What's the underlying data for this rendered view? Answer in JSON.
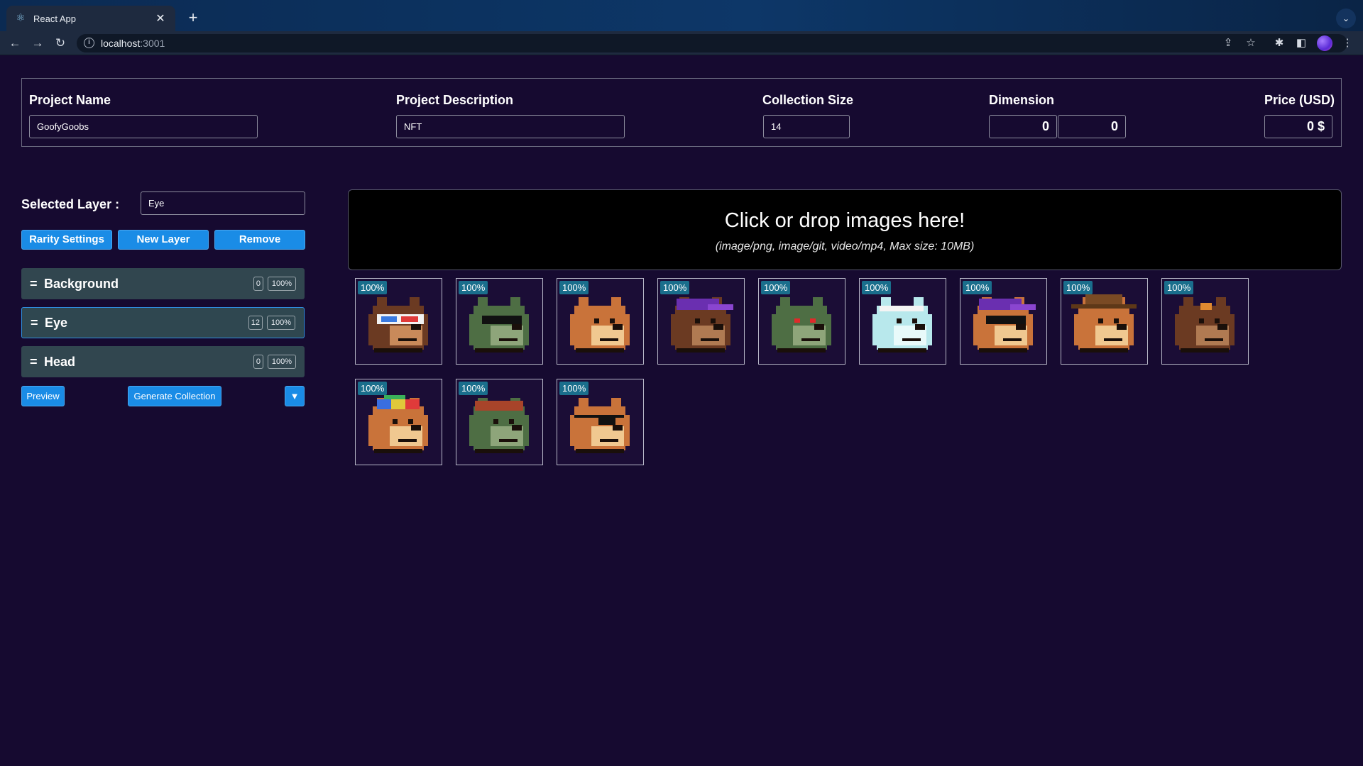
{
  "browser": {
    "tab_title": "React App",
    "url_host": "localhost",
    "url_port": ":3001"
  },
  "project": {
    "name_label": "Project Name",
    "name_value": "GoofyGoobs",
    "description_label": "Project Description",
    "description_value": "NFT",
    "collection_size_label": "Collection Size",
    "collection_size_value": "14",
    "dimension_label": "Dimension",
    "dimension_width": "0",
    "dimension_height": "0",
    "price_label": "Price (USD)",
    "price_value": "0 $"
  },
  "layers_panel": {
    "selected_label": "Selected Layer :",
    "selected_value": "Eye",
    "rarity_button": "Rarity Settings",
    "new_layer_button": "New Layer",
    "remove_button": "Remove",
    "handle_glyph": "=",
    "layers": [
      {
        "name": "Background",
        "count": "0",
        "percent": "100%",
        "selected": false
      },
      {
        "name": "Eye",
        "count": "12",
        "percent": "100%",
        "selected": true
      },
      {
        "name": "Head",
        "count": "0",
        "percent": "100%",
        "selected": false
      }
    ],
    "preview_button": "Preview",
    "generate_button": "Generate Collection",
    "dropdown_glyph": "▼"
  },
  "dropzone": {
    "title": "Click or drop images here!",
    "subtitle": "(image/png, image/git, video/mp4, Max size: 10MB)"
  },
  "images": [
    {
      "badge": "100%",
      "fur": "#6b3a22",
      "snout": "#c98a5a",
      "accessory": "3d-glasses"
    },
    {
      "badge": "100%",
      "fur": "#4e6e44",
      "snout": "#8ea57a",
      "accessory": "sunglasses"
    },
    {
      "badge": "100%",
      "fur": "#c9733a",
      "snout": "#f0c890",
      "accessory": "none"
    },
    {
      "badge": "100%",
      "fur": "#6b3a22",
      "snout": "#b07a52",
      "accessory": "purple-cap"
    },
    {
      "badge": "100%",
      "fur": "#4e6e44",
      "snout": "#8ea57a",
      "accessory": "red-eyes"
    },
    {
      "badge": "100%",
      "fur": "#b8e8ec",
      "snout": "#e8fafa",
      "accessory": "white-band"
    },
    {
      "badge": "100%",
      "fur": "#c9733a",
      "snout": "#f0c890",
      "accessory": "purple-cap-shades"
    },
    {
      "badge": "100%",
      "fur": "#c9733a",
      "snout": "#f0c890",
      "accessory": "cowboy-hat"
    },
    {
      "badge": "100%",
      "fur": "#6b3a22",
      "snout": "#b07a52",
      "accessory": "bow"
    },
    {
      "badge": "100%",
      "fur": "#c9733a",
      "snout": "#f0c890",
      "accessory": "propeller-cap"
    },
    {
      "badge": "100%",
      "fur": "#4e6e44",
      "snout": "#8ea57a",
      "accessory": "red-beanie"
    },
    {
      "badge": "100%",
      "fur": "#c9733a",
      "snout": "#f0c890",
      "accessory": "eye-patch"
    }
  ]
}
